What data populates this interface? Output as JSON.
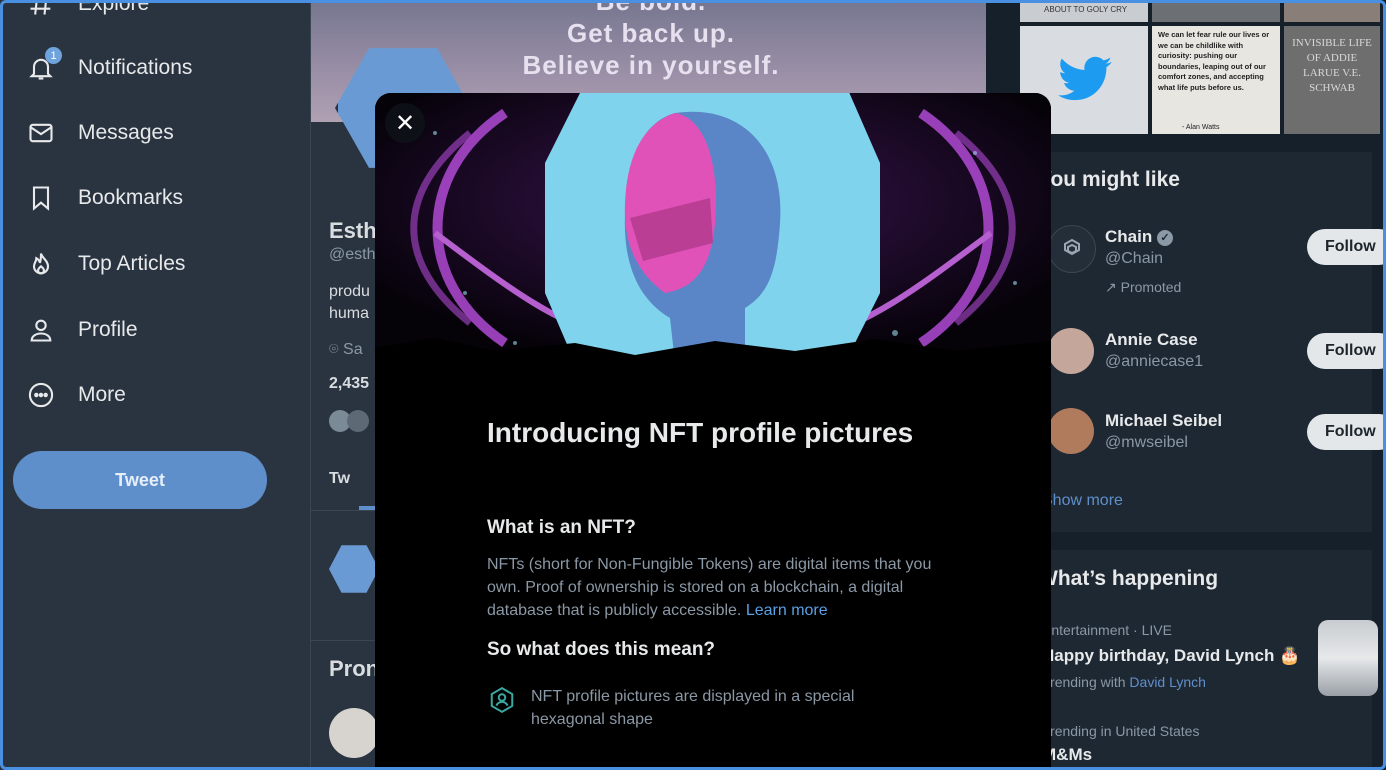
{
  "sidebar": {
    "items": [
      {
        "label": "Explore",
        "icon": "hashtag-icon"
      },
      {
        "label": "Notifications",
        "icon": "bell-icon",
        "badge": "1"
      },
      {
        "label": "Messages",
        "icon": "envelope-icon"
      },
      {
        "label": "Bookmarks",
        "icon": "bookmark-icon"
      },
      {
        "label": "Top Articles",
        "icon": "flame-icon"
      },
      {
        "label": "Profile",
        "icon": "person-icon"
      },
      {
        "label": "More",
        "icon": "more-circle-icon"
      }
    ],
    "tweet_label": "Tweet"
  },
  "profile": {
    "banner_quote": [
      "Be bold.",
      "Get back up.",
      "Believe in yourself."
    ],
    "name_partial": "Esth",
    "handle_partial": "@esth",
    "bio_line1": "produ",
    "bio_line2": "huma",
    "location_partial": "Sa",
    "stat_partial": "2,435",
    "tab_partial": "Tw",
    "promoted_partial": "Pron"
  },
  "right": {
    "photos": [
      "ABOUT TO GOLY CRY",
      "We can let fear rule our lives or we can be childlike with curiosity: pushing our boundaries, leaping out of our comfort zones, and accepting what life puts before us.",
      "- Alan Watts",
      "INVISIBLE LIFE OF ADDIE LARUE V.E. SCHWAB"
    ],
    "you_might_like_title": "You might like",
    "accounts": [
      {
        "name": "Chain",
        "handle": "@Chain",
        "verified": true,
        "promoted": "Promoted",
        "follow": "Follow"
      },
      {
        "name": "Annie Case",
        "handle": "@anniecase1",
        "follow": "Follow"
      },
      {
        "name": "Michael Seibel",
        "handle": "@mwseibel",
        "follow": "Follow"
      }
    ],
    "show_more": "Show more",
    "whats_happening_title": "What’s happening",
    "trends": [
      {
        "meta": "Entertainment · LIVE",
        "title": "Happy birthday, David Lynch 🎂",
        "trending_with": "Trending with",
        "link": "David Lynch"
      },
      {
        "meta": "Trending in United States",
        "title": "M&Ms"
      }
    ]
  },
  "modal": {
    "close_label": "✕",
    "title": "Introducing NFT profile pictures",
    "q1": "What is an NFT?",
    "body": "NFTs (short for Non-Fungible Tokens) are digital items that you own. Proof of ownership is stored on a blockchain, a digital database that is publicly accessible.",
    "learn_more": "Learn more",
    "q2": "So what does this mean?",
    "item1": "NFT profile pictures are displayed in a special hexagonal shape"
  },
  "colors": {
    "accent": "#5f8fcb",
    "modal_bg": "#000000",
    "hero_purple": "#b24bd6",
    "hero_cyan": "#7fd3ec",
    "hero_pink": "#e052b8"
  }
}
